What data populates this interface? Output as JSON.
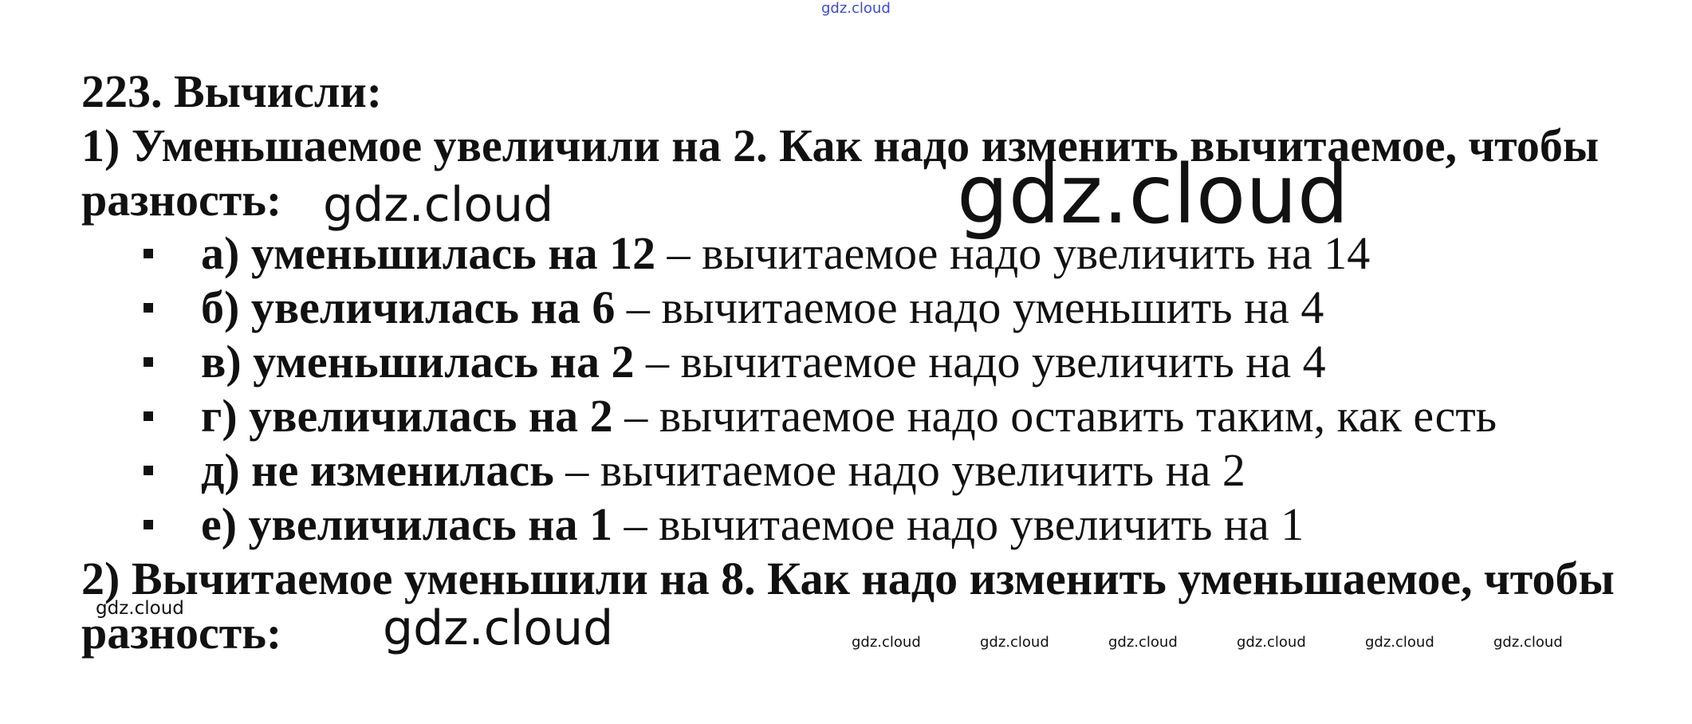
{
  "watermark": "gdz.cloud",
  "title": "223. Вычисли:",
  "task1": {
    "question_line1": "1) Уменьшаемое увеличили на 2. Как надо изменить вычитаемое, чтобы",
    "question_line2": "разность:",
    "items": [
      {
        "condition": "а) уменьшилась на 12",
        "answer": " – вычитаемое надо увеличить на 14"
      },
      {
        "condition": "б) увеличилась на 6",
        "answer": " – вычитаемое надо уменьшить на 4"
      },
      {
        "condition": "в) уменьшилась на 2",
        "answer": " – вычитаемое надо увеличить на 4"
      },
      {
        "condition": "г) увеличилась на 2",
        "answer": " – вычитаемое надо оставить таким, как есть"
      },
      {
        "condition": "д) не изменилась",
        "answer": " – вычитаемое надо увеличить на 2"
      },
      {
        "condition": "е) увеличилась на 1",
        "answer": " – вычитаемое надо увеличить на 1"
      }
    ]
  },
  "task2": {
    "question_line1": "2) Вычитаемое уменьшили на 8. Как надо изменить уменьшаемое, чтобы",
    "question_line2": "разность:"
  }
}
